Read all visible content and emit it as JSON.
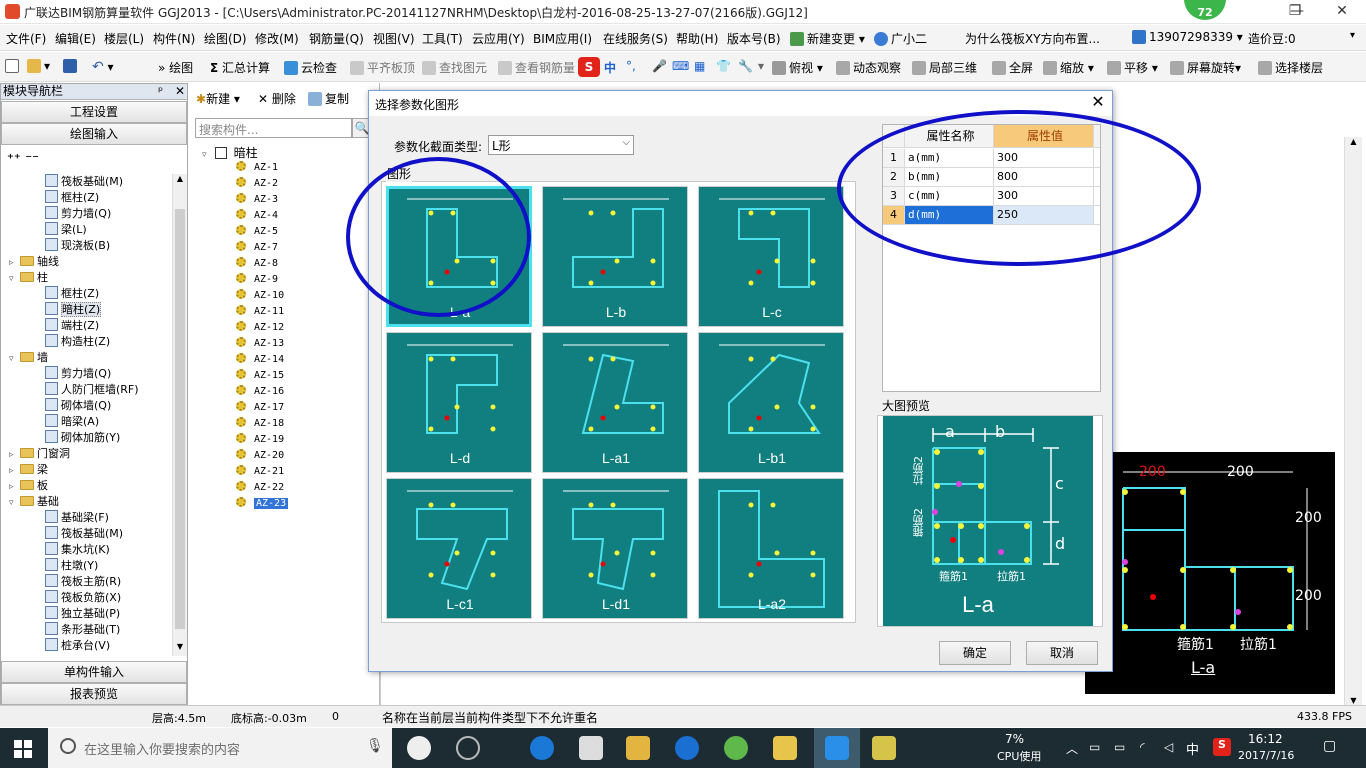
{
  "window": {
    "title": "广联达BIM钢筋算量软件 GGJ2013 - [C:\\Users\\Administrator.PC-20141127NRHM\\Desktop\\白龙村-2016-08-25-13-27-07(2166版).GGJ12]",
    "badge": "72",
    "controls": {
      "minimize": "—",
      "restore": "❐",
      "close": "✕"
    }
  },
  "menu": [
    "文件(F)",
    "编辑(E)",
    "楼层(L)",
    "构件(N)",
    "绘图(D)",
    "修改(M)",
    "钢筋量(Q)",
    "视图(V)",
    "工具(T)",
    "云应用(Y)",
    "BIM应用(I)",
    "在线服务(S)",
    "帮助(H)",
    "版本号(B)",
    "新建变更",
    "广小二",
    "为什么筏板XY方向布置...",
    "13907298339",
    "造价豆:0"
  ],
  "toolbar": {
    "draw": "绘图",
    "sum": "汇总计算",
    "cloud": "云检查",
    "flat": "平齐板顶",
    "find": "查找图元",
    "view_rebar": "查看钢筋量",
    "top_view": "俯视",
    "dynamic": "动态观察",
    "local3d": "局部三维",
    "fullscreen": "全屏",
    "zoom": "缩放",
    "pan": "平移",
    "rotate": "屏幕旋转",
    "select_floor": "选择楼层",
    "ime": "中"
  },
  "nav": {
    "header": "模块导航栏",
    "pin": "ᵖ",
    "close": "✕",
    "buttons": [
      "工程设置",
      "绘图输入"
    ],
    "bottom_buttons": [
      "单构件输入",
      "报表预览"
    ],
    "tree": [
      {
        "label": "筏板基础(M)",
        "level": 2,
        "type": "comp"
      },
      {
        "label": "框柱(Z)",
        "level": 2,
        "type": "comp"
      },
      {
        "label": "剪力墙(Q)",
        "level": 2,
        "type": "comp"
      },
      {
        "label": "梁(L)",
        "level": 2,
        "type": "comp"
      },
      {
        "label": "现浇板(B)",
        "level": 2,
        "type": "comp"
      },
      {
        "label": "轴线",
        "level": 1,
        "type": "folder",
        "tw": "▹"
      },
      {
        "label": "柱",
        "level": 1,
        "type": "folder",
        "tw": "▿"
      },
      {
        "label": "框柱(Z)",
        "level": 2,
        "type": "comp"
      },
      {
        "label": "暗柱(Z)",
        "level": 2,
        "type": "comp",
        "selected": true
      },
      {
        "label": "端柱(Z)",
        "level": 2,
        "type": "comp"
      },
      {
        "label": "构造柱(Z)",
        "level": 2,
        "type": "comp"
      },
      {
        "label": "墙",
        "level": 1,
        "type": "folder",
        "tw": "▿"
      },
      {
        "label": "剪力墙(Q)",
        "level": 2,
        "type": "comp"
      },
      {
        "label": "人防门框墙(RF)",
        "level": 2,
        "type": "comp"
      },
      {
        "label": "砌体墙(Q)",
        "level": 2,
        "type": "comp"
      },
      {
        "label": "暗梁(A)",
        "level": 2,
        "type": "comp"
      },
      {
        "label": "砌体加筋(Y)",
        "level": 2,
        "type": "comp"
      },
      {
        "label": "门窗洞",
        "level": 1,
        "type": "folder",
        "tw": "▹"
      },
      {
        "label": "梁",
        "level": 1,
        "type": "folder",
        "tw": "▹"
      },
      {
        "label": "板",
        "level": 1,
        "type": "folder",
        "tw": "▹"
      },
      {
        "label": "基础",
        "level": 1,
        "type": "folder",
        "tw": "▿"
      },
      {
        "label": "基础梁(F)",
        "level": 2,
        "type": "comp"
      },
      {
        "label": "筏板基础(M)",
        "level": 2,
        "type": "comp"
      },
      {
        "label": "集水坑(K)",
        "level": 2,
        "type": "comp"
      },
      {
        "label": "柱墩(Y)",
        "level": 2,
        "type": "comp"
      },
      {
        "label": "筏板主筋(R)",
        "level": 2,
        "type": "comp"
      },
      {
        "label": "筏板负筋(X)",
        "level": 2,
        "type": "comp"
      },
      {
        "label": "独立基础(P)",
        "level": 2,
        "type": "comp"
      },
      {
        "label": "条形基础(T)",
        "level": 2,
        "type": "comp"
      },
      {
        "label": "桩承台(V)",
        "level": 2,
        "type": "comp"
      }
    ]
  },
  "components": {
    "new": "新建",
    "delete": "删除",
    "copy": "复制",
    "search_placeholder": "搜索构件...",
    "root": "暗柱",
    "items": [
      "AZ-1",
      "AZ-2",
      "AZ-3",
      "AZ-4",
      "AZ-5",
      "AZ-7",
      "AZ-8",
      "AZ-9",
      "AZ-10",
      "AZ-11",
      "AZ-12",
      "AZ-13",
      "AZ-14",
      "AZ-15",
      "AZ-16",
      "AZ-17",
      "AZ-18",
      "AZ-19",
      "AZ-20",
      "AZ-21",
      "AZ-22",
      "AZ-23"
    ],
    "selected": "AZ-23"
  },
  "dialog": {
    "title": "选择参数化图形",
    "close": "✕",
    "type_label": "参数化截面类型:",
    "type_value": "L形",
    "group_label": "图形",
    "shapes": [
      "L-a",
      "L-b",
      "L-c",
      "L-d",
      "L-a1",
      "L-b1",
      "L-c1",
      "L-d1",
      "L-a2"
    ],
    "selected_shape": "L-a",
    "props": {
      "col_name": "属性名称",
      "col_value": "属性值",
      "rows": [
        {
          "no": "1",
          "name": "a(mm)",
          "value": "300"
        },
        {
          "no": "2",
          "name": "b(mm)",
          "value": "800"
        },
        {
          "no": "3",
          "name": "c(mm)",
          "value": "300"
        },
        {
          "no": "4",
          "name": "d(mm)",
          "value": "250"
        }
      ]
    },
    "preview_label": "大图预览",
    "preview_name": "L-a",
    "labels": {
      "a": "a",
      "b": "b",
      "c": "c",
      "d": "d",
      "tie2": "拉筋2",
      "stirrup2": "箍筋2",
      "stirrup1": "箍筋1",
      "tie1": "拉筋1"
    },
    "ok": "确定",
    "cancel": "取消"
  },
  "canvas": {
    "dims": [
      "200",
      "200",
      "200",
      "200"
    ],
    "labels": [
      "箍筋1",
      "拉筋1"
    ],
    "name": "L-a"
  },
  "status": {
    "floor_height": "层高:4.5m",
    "base_height": "底标高:-0.03m",
    "zero": "0",
    "message": "名称在当前层当前构件类型下不允许重名",
    "fps": "433.8 FPS"
  },
  "taskbar": {
    "search": "在这里输入你要搜索的内容",
    "cpu_pct": "7%",
    "cpu_label": "CPU使用",
    "ime": "中",
    "time": "16:12",
    "date": "2017/7/16"
  },
  "colors": {
    "teal": "#117f7f",
    "highlight": "#4ce0ef",
    "annotation": "#1010c8"
  }
}
